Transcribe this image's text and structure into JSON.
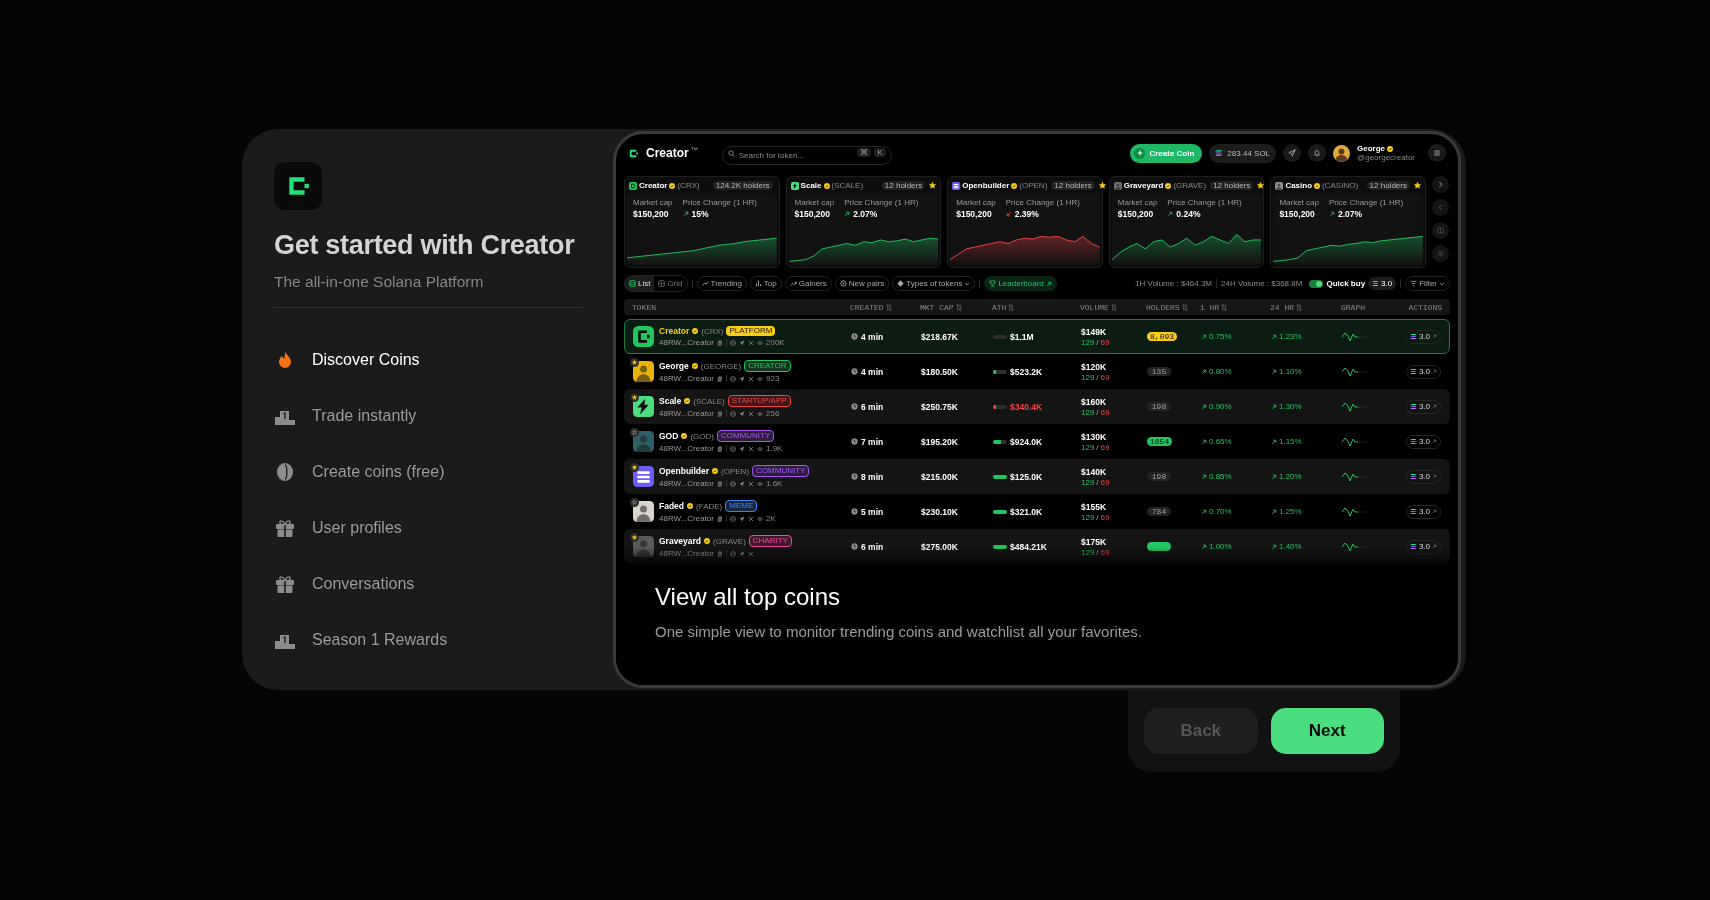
{
  "intro": {
    "title": "Get started with Creator",
    "subtitle": "The all-in-one Solana Platform",
    "steps": [
      {
        "label": "Discover Coins",
        "kind": "flame",
        "selected": true
      },
      {
        "label": "Trade instantly",
        "kind": "podium",
        "selected": false
      },
      {
        "label": "Create coins (free)",
        "kind": "coin",
        "selected": false
      },
      {
        "label": "User profiles",
        "kind": "gift",
        "selected": false
      },
      {
        "label": "Conversations",
        "kind": "gift",
        "selected": false
      },
      {
        "label": "Season 1 Rewards",
        "kind": "podium",
        "selected": false
      }
    ]
  },
  "preview": {
    "header": {
      "brand": "Creator",
      "brand_mark": "™",
      "search": {
        "placeholder": "Search for token...",
        "shortcut": [
          "⌘",
          "K"
        ]
      },
      "create_button": "Create Coin",
      "balance": "283.44 SOL",
      "user": {
        "name": "George",
        "handle": "@georgecreator"
      }
    },
    "cards": [
      {
        "name": "Creator",
        "ticker": "(CRX)",
        "holders": "124.2K holders",
        "starred": false,
        "logo": {
          "kind": "ring",
          "color": "#22c55e"
        },
        "market_cap_label": "Market cap",
        "market_cap": "$150,200",
        "change_label": "Price Change (1 HR)",
        "change": "15%",
        "negative": false
      },
      {
        "name": "Scale",
        "ticker": "(SCALE)",
        "holders": "12 holders",
        "starred": true,
        "logo": {
          "kind": "bolt",
          "color": "#4ade80"
        },
        "market_cap_label": "Market cap",
        "market_cap": "$150,200",
        "change_label": "Price Change (1 HR)",
        "change": "2.07%",
        "negative": false
      },
      {
        "name": "Openbuilder",
        "ticker": "(OPEN)",
        "holders": "12 holders",
        "starred": true,
        "logo": {
          "kind": "stripes",
          "color": "#6d5cf6"
        },
        "market_cap_label": "Market cap",
        "market_cap": "$150,200",
        "change_label": "Price Change (1 HR)",
        "change": "2.39%",
        "negative": true
      },
      {
        "name": "Graveyard",
        "ticker": "(GRAVE)",
        "holders": "12 holders",
        "starred": true,
        "logo": {
          "kind": "figure",
          "color": "#6b6b6b"
        },
        "market_cap_label": "Market cap",
        "market_cap": "$150,200",
        "change_label": "Price Change (1 HR)",
        "change": "0.24%",
        "negative": false
      },
      {
        "name": "Casino",
        "ticker": "(CASINO)",
        "holders": "12 holders",
        "starred": true,
        "logo": {
          "kind": "figure",
          "color": "#8a8a8a"
        },
        "market_cap_label": "Market cap",
        "market_cap": "$150,200",
        "change_label": "Price Change (1 HR)",
        "change": "2.07%",
        "negative": false
      }
    ],
    "toolbar": {
      "views": [
        {
          "label": "List",
          "kind": "list",
          "selected": true
        },
        {
          "label": "Grid",
          "kind": "grid",
          "selected": false
        }
      ],
      "filters": [
        {
          "label": "Trending",
          "kind": "trending"
        },
        {
          "label": "Top",
          "kind": "top"
        },
        {
          "label": "Gainers",
          "kind": "gainers"
        },
        {
          "label": "New pairs",
          "kind": "new"
        },
        {
          "label": "Types of tokens",
          "kind": "dropdown"
        }
      ],
      "leaderboard": "Leaderboard",
      "volume_1h": "1H Volume : $464.3M",
      "volume_24h": "24H Volume : $368.8M",
      "quick_buy": {
        "label": "Quick buy",
        "on": true,
        "amount": "3.0"
      },
      "filter": "Filter"
    },
    "table": {
      "columns": [
        {
          "label": "TOKEN",
          "sortable": false
        },
        {
          "label": "CREATED",
          "sortable": true
        },
        {
          "label": "MKT CAP",
          "sortable": true
        },
        {
          "label": "ATH",
          "sortable": true
        },
        {
          "label": "VOLUME",
          "sortable": true
        },
        {
          "label": "HOLDERS",
          "sortable": true
        },
        {
          "label": "1 HR",
          "sortable": true
        },
        {
          "label": "24 HR",
          "sortable": true
        },
        {
          "label": "GRAPH",
          "sortable": false
        },
        {
          "label": "ACTIONS",
          "sortable": false
        }
      ],
      "rows": [
        {
          "selected": true,
          "avatar": {
            "kind": "ring",
            "color": "#22c55e"
          },
          "name": "Creator",
          "ticker": "(CRX)",
          "tag": {
            "label": "PLATFORM",
            "kind": "solid",
            "color": "#facc15"
          },
          "address": "48RW...Creator",
          "views": "200K",
          "created": "4 min",
          "market_cap": "$218.67K",
          "ath": {
            "value": "$1.1M",
            "level": 0,
            "negative": false
          },
          "volume": "$149K",
          "trades": {
            "buys": "129",
            "separator": "/",
            "sells": "69"
          },
          "holders": {
            "label": "8,093",
            "kind": "solid",
            "color": "#facc15"
          },
          "change_1h": "0.75%",
          "change_24h": "1.23%",
          "buy_amount": "3.0"
        },
        {
          "selected": false,
          "starred": true,
          "avatar": {
            "kind": "figure",
            "color": "#eab308"
          },
          "name": "George",
          "ticker": "(GEORGE)",
          "tag": {
            "label": "CREATOR",
            "kind": "soft",
            "color": "#22c55e"
          },
          "address": "48RW...Creator",
          "views": "923",
          "created": "4 min",
          "market_cap": "$180.50K",
          "ath": {
            "value": "$523.2K",
            "level": 0.2,
            "negative": false
          },
          "volume": "$120K",
          "trades": {
            "buys": "129",
            "separator": "/",
            "sells": "69"
          },
          "holders": {
            "label": "135",
            "kind": "plain"
          },
          "change_1h": "0.80%",
          "change_24h": "1.10%",
          "buy_amount": "3.0"
        },
        {
          "selected": false,
          "starred": true,
          "avatar": {
            "kind": "bolt",
            "color": "#4ade80"
          },
          "name": "Scale",
          "ticker": "(SCALE)",
          "tag": {
            "label": "STARTUP/APP",
            "kind": "soft",
            "color": "#ef4444"
          },
          "address": "48RW...Creator",
          "views": "256",
          "created": "6 min",
          "market_cap": "$250.75K",
          "ath": {
            "value": "$340.4K",
            "level": 0.2,
            "negative": true
          },
          "volume": "$160K",
          "trades": {
            "buys": "129",
            "separator": "/",
            "sells": "69"
          },
          "holders": {
            "label": "198",
            "kind": "plain"
          },
          "change_1h": "0.90%",
          "change_24h": "1.30%",
          "buy_amount": "3.0"
        },
        {
          "selected": false,
          "starred": false,
          "avatar": {
            "kind": "figure",
            "color": "#2f5f66"
          },
          "name": "GOD",
          "ticker": "(GOD)",
          "tag": {
            "label": "COMMUNITY",
            "kind": "soft",
            "color": "#a855f7"
          },
          "address": "48RW...Creator",
          "views": "1.9K",
          "created": "7 min",
          "market_cap": "$195.20K",
          "ath": {
            "value": "$924.0K",
            "level": 0.55,
            "negative": false
          },
          "volume": "$130K",
          "trades": {
            "buys": "129",
            "separator": "/",
            "sells": "69"
          },
          "holders": {
            "label": "1654",
            "kind": "solid",
            "color": "#22c55e"
          },
          "change_1h": "0.65%",
          "change_24h": "1.15%",
          "buy_amount": "3.0"
        },
        {
          "selected": false,
          "starred": true,
          "avatar": {
            "kind": "stripes",
            "color": "#6d5cf6"
          },
          "name": "Openbuilder",
          "ticker": "(OPEN)",
          "tag": {
            "label": "COMMUNITY",
            "kind": "soft",
            "color": "#a855f7"
          },
          "address": "48RW...Creator",
          "views": "1.6K",
          "created": "8 min",
          "market_cap": "$215.00K",
          "ath": {
            "value": "$125.0K",
            "level": 1,
            "negative": false
          },
          "volume": "$140K",
          "trades": {
            "buys": "129",
            "separator": "/",
            "sells": "69"
          },
          "holders": {
            "label": "198",
            "kind": "plain"
          },
          "change_1h": "0.85%",
          "change_24h": "1.20%",
          "buy_amount": "3.0"
        },
        {
          "selected": false,
          "starred": false,
          "avatar": {
            "kind": "figure",
            "color": "#d9d4cc"
          },
          "name": "Faded",
          "ticker": "(FADE)",
          "tag": {
            "label": "MEME",
            "kind": "soft",
            "color": "#3b82f6"
          },
          "address": "48RW...Creator",
          "views": "2K",
          "created": "5 min",
          "market_cap": "$230.10K",
          "ath": {
            "value": "$321.0K",
            "level": 1,
            "negative": false
          },
          "volume": "$155K",
          "trades": {
            "buys": "129",
            "separator": "/",
            "sells": "69"
          },
          "holders": {
            "label": "784",
            "kind": "plain"
          },
          "change_1h": "0.70%",
          "change_24h": "1.25%",
          "buy_amount": "3.0"
        },
        {
          "selected": false,
          "starred": true,
          "avatar": {
            "kind": "figure",
            "color": "#5a5a5a"
          },
          "name": "Graveyard",
          "ticker": "(GRAVE)",
          "tag": {
            "label": "CHARITY",
            "kind": "soft",
            "color": "#ec4899"
          },
          "address": "48RW...Creator",
          "created": "6 min",
          "market_cap": "$275.00K",
          "ath": {
            "value": "$484.21K",
            "level": 1,
            "negative": false
          },
          "volume": "$175K",
          "trades": {
            "buys": "129",
            "separator": "/",
            "sells": "69"
          },
          "holders": {
            "kind": "solid",
            "color": "#22c55e"
          },
          "change_1h": "1.00%",
          "change_24h": "1.40%",
          "buy_amount": "3.0"
        }
      ]
    },
    "overlay": {
      "title": "View all top coins",
      "text": "One simple view to monitor trending coins and watchlist all your favorites."
    }
  },
  "buttons": [
    {
      "label": "Back",
      "disabled": true
    },
    {
      "label": "Next",
      "disabled": false
    }
  ]
}
